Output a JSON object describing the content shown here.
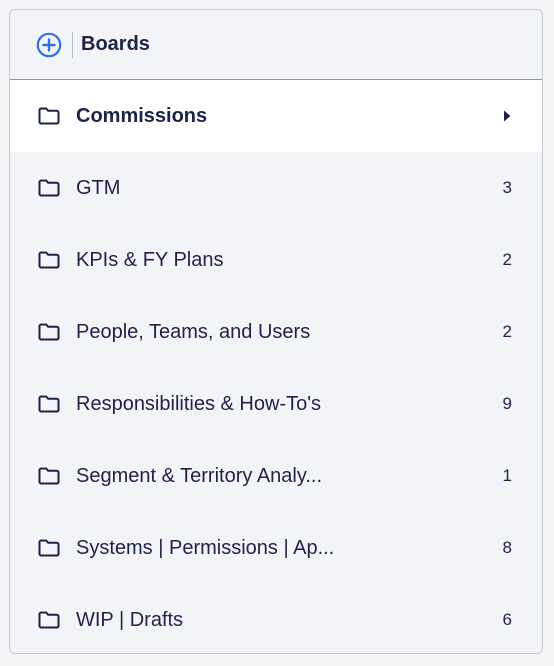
{
  "header": {
    "title": "Boards",
    "add_icon": "plus-circle-icon",
    "accent_color": "#2f6fe8"
  },
  "boards": [
    {
      "label": "Commissions",
      "count": "",
      "selected": true
    },
    {
      "label": "GTM",
      "count": "3"
    },
    {
      "label": "KPIs & FY Plans",
      "count": "2"
    },
    {
      "label": "People, Teams, and Users",
      "count": "2"
    },
    {
      "label": "Responsibilities & How-To's",
      "count": "9"
    },
    {
      "label": "Segment & Territory Analy...",
      "count": "1"
    },
    {
      "label": "Systems | Permissions | Ap...",
      "count": "8"
    },
    {
      "label": "WIP | Drafts",
      "count": "6"
    }
  ]
}
